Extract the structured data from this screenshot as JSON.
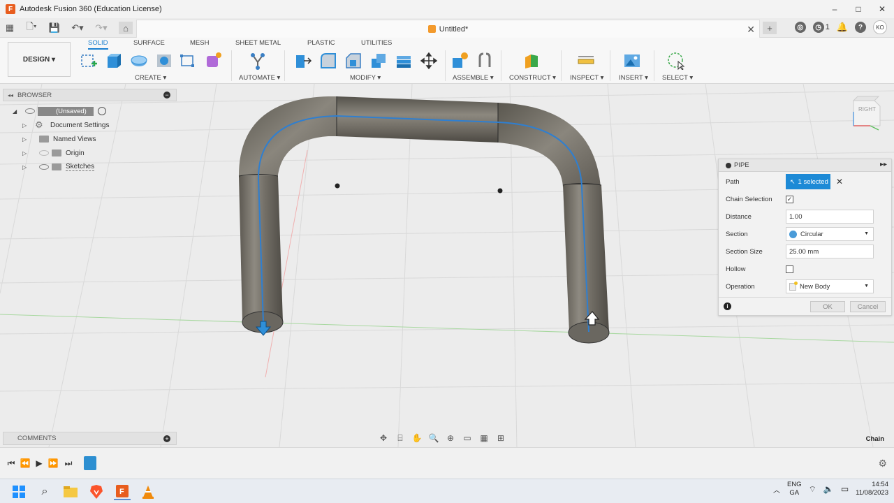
{
  "window": {
    "title": "Autodesk Fusion 360 (Education License)",
    "controls": [
      "–",
      "□",
      "✕"
    ]
  },
  "document_tab": {
    "title": "Untitled*"
  },
  "user": {
    "initials": "KO",
    "notifications": "1"
  },
  "workspace": {
    "label": "DESIGN ▾"
  },
  "toolbar_tabs": [
    "SOLID",
    "SURFACE",
    "MESH",
    "SHEET METAL",
    "PLASTIC",
    "UTILITIES"
  ],
  "toolbar_groups": {
    "create": "CREATE ▾",
    "automate": "AUTOMATE ▾",
    "modify": "MODIFY ▾",
    "assemble": "ASSEMBLE ▾",
    "construct": "CONSTRUCT ▾",
    "inspect": "INSPECT ▾",
    "insert": "INSERT ▾",
    "select": "SELECT ▾"
  },
  "browser": {
    "header": "BROWSER",
    "items": [
      {
        "label": "(Unsaved)"
      },
      {
        "label": "Document Settings"
      },
      {
        "label": "Named Views"
      },
      {
        "label": "Origin"
      },
      {
        "label": "Sketches"
      }
    ]
  },
  "viewcube": {
    "face": "RIGHT"
  },
  "pipe_dialog": {
    "title": "PIPE",
    "path_label": "Path",
    "path_value": "1 selected",
    "chain_label": "Chain Selection",
    "chain_checked": "✓",
    "distance_label": "Distance",
    "distance_value": "1.00",
    "section_label": "Section",
    "section_value": "Circular",
    "section_size_label": "Section Size",
    "section_size_value": "25.00 mm",
    "hollow_label": "Hollow",
    "operation_label": "Operation",
    "operation_value": "New Body",
    "ok": "OK",
    "cancel": "Cancel"
  },
  "comments": {
    "header": "COMMENTS"
  },
  "status": {
    "mode": "Chain"
  },
  "taskbar": {
    "lang1": "ENG",
    "lang2": "GA",
    "time": "14:54",
    "date": "11/08/2023"
  },
  "colors": {
    "accent": "#1d8ad6",
    "brand": "#e85d1e",
    "pipe": "#6f6b63"
  }
}
